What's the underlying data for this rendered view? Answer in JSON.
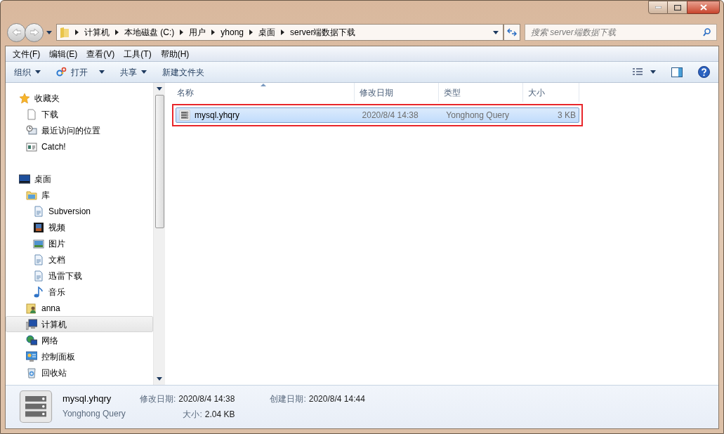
{
  "address_bar": {
    "segments": [
      "计算机",
      "本地磁盘 (C:)",
      "用户",
      "yhong",
      "桌面",
      "server端数据下载"
    ]
  },
  "search": {
    "placeholder": "搜索 server端数据下载"
  },
  "menu_bar": [
    "文件(F)",
    "编辑(E)",
    "查看(V)",
    "工具(T)",
    "帮助(H)"
  ],
  "toolbar": [
    {
      "label": "组织",
      "kind": "dropdown"
    },
    {
      "label": "打开",
      "kind": "open"
    },
    {
      "label": "共享",
      "kind": "dropdown"
    },
    {
      "label": "新建文件夹",
      "kind": "plain"
    }
  ],
  "sidebar": {
    "groups": [
      {
        "label": "收藏夹",
        "selected": false,
        "children": [
          {
            "label": "下载",
            "selected": false
          },
          {
            "label": "最近访问的位置",
            "selected": false
          },
          {
            "label": "Catch!",
            "selected": false
          }
        ]
      },
      {
        "label": "桌面",
        "selected": false,
        "children": [
          {
            "label": "库",
            "selected": false,
            "children": [
              {
                "label": "Subversion",
                "selected": false
              },
              {
                "label": "视频",
                "selected": false
              },
              {
                "label": "图片",
                "selected": false
              },
              {
                "label": "文档",
                "selected": false
              },
              {
                "label": "迅雷下载",
                "selected": false
              },
              {
                "label": "音乐",
                "selected": false
              }
            ]
          },
          {
            "label": "anna",
            "selected": false
          },
          {
            "label": "计算机",
            "selected": true
          },
          {
            "label": "网络",
            "selected": false
          },
          {
            "label": "控制面板",
            "selected": false
          },
          {
            "label": "回收站",
            "selected": false
          }
        ]
      }
    ]
  },
  "table": {
    "columns": [
      {
        "label": "名称",
        "sorted": true
      },
      {
        "label": "修改日期",
        "sorted": false
      },
      {
        "label": "类型",
        "sorted": false
      },
      {
        "label": "大小",
        "sorted": false
      }
    ],
    "rows": [
      {
        "name": "mysql.yhqry",
        "modified": "2020/8/4 14:38",
        "type": "Yonghong Query",
        "size": "3 KB",
        "selected": true,
        "annotated": true
      }
    ]
  },
  "details": {
    "name": "mysql.yhqry",
    "type": "Yonghong Query",
    "fields": [
      {
        "label": "修改日期:",
        "value": "2020/8/4 14:38"
      },
      {
        "label": "创建日期:",
        "value": "2020/8/4 14:44"
      },
      {
        "label": "大小:",
        "value": "2.04 KB"
      }
    ]
  }
}
